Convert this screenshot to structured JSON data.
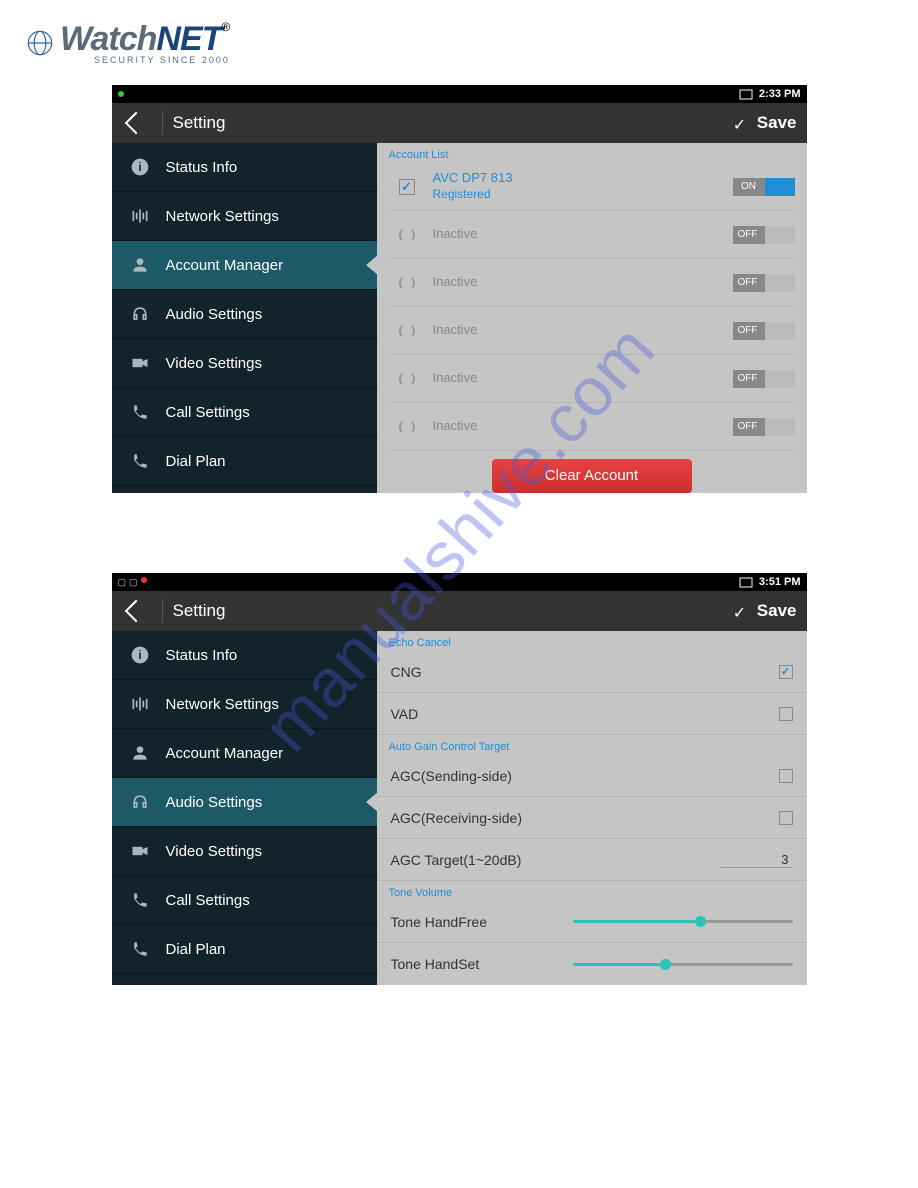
{
  "logo": {
    "watch": "Watch",
    "net": "NET",
    "reg": "®",
    "tagline": "SECURITY SINCE 2000"
  },
  "watermark": "manualshive.com",
  "shot1": {
    "status_time": "2:33 PM",
    "header_title": "Setting",
    "save_label": "Save",
    "sidebar": [
      {
        "label": "Status Info"
      },
      {
        "label": "Network Settings"
      },
      {
        "label": "Account Manager"
      },
      {
        "label": "Audio Settings"
      },
      {
        "label": "Video Settings"
      },
      {
        "label": "Call Settings"
      },
      {
        "label": "Dial Plan"
      }
    ],
    "section_label": "Account List",
    "accounts": [
      {
        "name": "AVC DP7 813",
        "status": "Registered",
        "toggle": "ON",
        "on": true
      },
      {
        "name": "Inactive",
        "toggle": "OFF",
        "on": false
      },
      {
        "name": "Inactive",
        "toggle": "OFF",
        "on": false
      },
      {
        "name": "Inactive",
        "toggle": "OFF",
        "on": false
      },
      {
        "name": "Inactive",
        "toggle": "OFF",
        "on": false
      },
      {
        "name": "Inactive",
        "toggle": "OFF",
        "on": false
      }
    ],
    "clear_btn": "Clear Account"
  },
  "shot2": {
    "status_time": "3:51 PM",
    "header_title": "Setting",
    "save_label": "Save",
    "sidebar": [
      {
        "label": "Status Info"
      },
      {
        "label": "Network Settings"
      },
      {
        "label": "Account Manager"
      },
      {
        "label": "Audio Settings"
      },
      {
        "label": "Video Settings"
      },
      {
        "label": "Call Settings"
      },
      {
        "label": "Dial Plan"
      }
    ],
    "section1": "Echo Cancel",
    "echo": [
      {
        "label": "CNG",
        "checked": true
      },
      {
        "label": "VAD",
        "checked": false
      }
    ],
    "section2": "Auto Gain Control Target",
    "agc": [
      {
        "label": "AGC(Sending-side)",
        "type": "checkbox",
        "checked": false
      },
      {
        "label": "AGC(Receiving-side)",
        "type": "checkbox",
        "checked": false
      },
      {
        "label": "AGC Target(1~20dB)",
        "type": "value",
        "value": "3"
      }
    ],
    "section3": "Tone Volume",
    "tones": [
      {
        "label": "Tone HandFree",
        "pct": 58
      },
      {
        "label": "Tone HandSet",
        "pct": 42
      }
    ]
  }
}
